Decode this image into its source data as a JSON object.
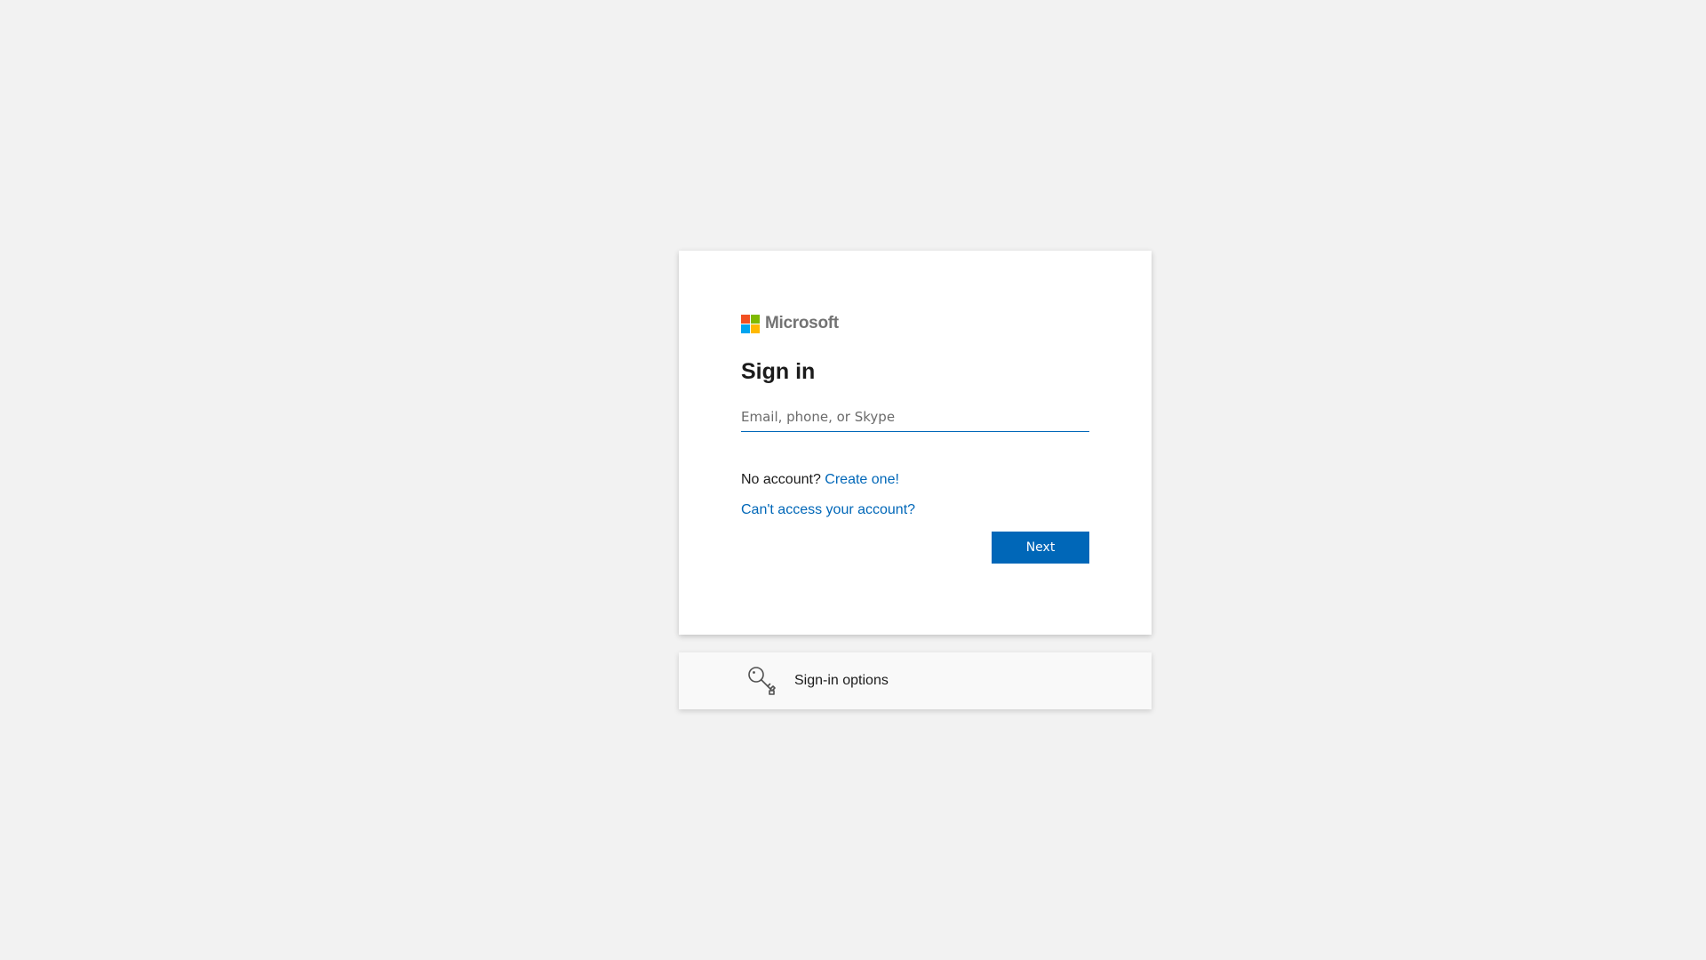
{
  "brand": {
    "name": "Microsoft",
    "logo_colors": [
      "#f25022",
      "#7fba00",
      "#00a4ef",
      "#ffb900"
    ]
  },
  "signin": {
    "title": "Sign in",
    "email_placeholder": "Email, phone, or Skype",
    "email_value": "",
    "no_account_text": "No account?",
    "create_link": "Create one!",
    "cant_access_link": "Can't access your account?",
    "next_label": "Next"
  },
  "options": {
    "label": "Sign-in options",
    "icon": "key-icon"
  },
  "colors": {
    "accent": "#0067b8",
    "background": "#f2f2f2"
  }
}
